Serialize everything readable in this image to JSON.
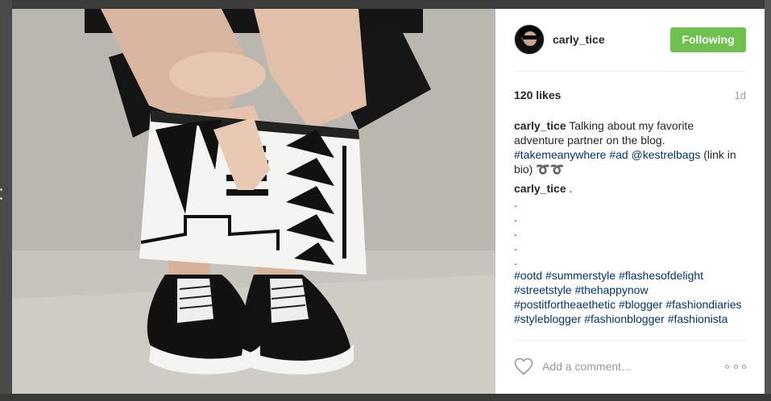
{
  "post": {
    "username": "carly_tice",
    "follow_label": "Following",
    "likes": "120 likes",
    "time": "1d"
  },
  "comments": [
    {
      "author": "carly_tice",
      "text_1": "Talking about my favorite adventure partner on the blog.",
      "tag_1": "#takemeanywhere",
      "tag_2": "#ad",
      "tag_3": "@kestrelbags",
      "text_2": "(link in bio) ➰➰"
    },
    {
      "author": "carly_tice",
      "text_1": ".",
      "dots": [
        ".",
        ".",
        ".",
        ".",
        "."
      ],
      "hashtags": [
        "#ootd",
        "#summerstyle",
        "#flashesofdelight",
        "#streetstyle",
        "#thehappynow",
        "#postitfortheaethetic",
        "#blogger",
        "#fashiondiaries",
        "#styleblogger",
        "#fashionblogger",
        "#fashionista"
      ]
    }
  ],
  "comment_input": {
    "placeholder": "Add a comment…"
  },
  "icons": {
    "like": "heart-icon",
    "more": "more-options-icon"
  },
  "colors": {
    "follow_button": "#70c050",
    "hashtag": "#003569"
  }
}
